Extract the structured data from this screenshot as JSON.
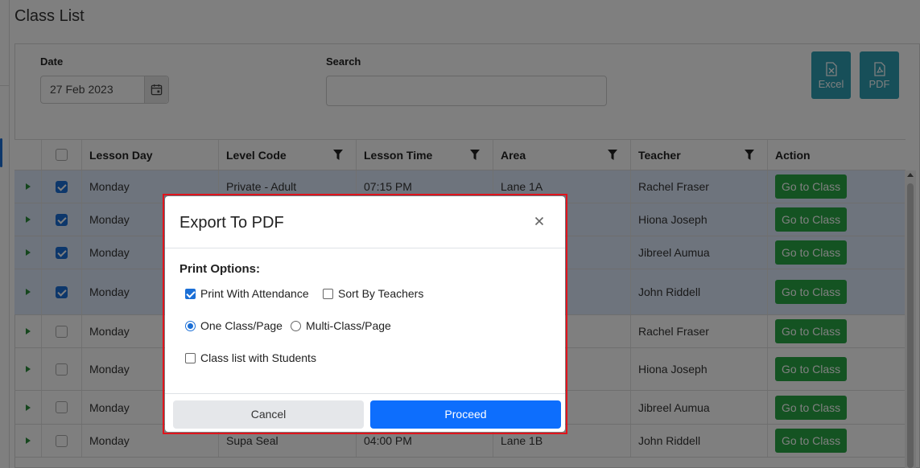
{
  "page": {
    "title": "Class List"
  },
  "filters": {
    "date_label": "Date",
    "date_value": "27 Feb 2023",
    "search_label": "Search",
    "search_value": ""
  },
  "export": {
    "excel_label": "Excel",
    "pdf_label": "PDF"
  },
  "grid": {
    "columns": [
      "Lesson Day",
      "Level Code",
      "Lesson Time",
      "Area",
      "Teacher",
      "Action"
    ],
    "rows": [
      {
        "selected": true,
        "day": "Monday",
        "level": "Private - Adult",
        "time": "07:15 PM",
        "area": "Lane 1A",
        "teacher": "Rachel Fraser",
        "action": "Go to Class"
      },
      {
        "selected": true,
        "day": "Monday",
        "level": "",
        "time": "",
        "area": "",
        "teacher": "Hiona Joseph",
        "action": "Go to Class"
      },
      {
        "selected": true,
        "day": "Monday",
        "level": "",
        "time": "",
        "area": "",
        "teacher": "Jibreel Aumua",
        "action": "Go to Class"
      },
      {
        "selected": true,
        "day": "Monday",
        "level": "",
        "time": "",
        "area": "",
        "teacher": "John Riddell",
        "action": "Go to Class"
      },
      {
        "selected": false,
        "day": "Monday",
        "level": "",
        "time": "",
        "area": "",
        "teacher": "Rachel Fraser",
        "action": "Go to Class"
      },
      {
        "selected": false,
        "day": "Monday",
        "level": "",
        "time": "",
        "area": "",
        "teacher": "Hiona Joseph",
        "action": "Go to Class"
      },
      {
        "selected": false,
        "day": "Monday",
        "level": "",
        "time": "",
        "area": "",
        "teacher": "Jibreel Aumua",
        "action": "Go to Class"
      },
      {
        "selected": false,
        "day": "Monday",
        "level": "Supa Seal",
        "time": "04:00 PM",
        "area": "Lane 1B",
        "teacher": "John Riddell",
        "action": "Go to Class"
      }
    ]
  },
  "modal": {
    "title": "Export To PDF",
    "section_title": "Print Options:",
    "print_with_attendance": {
      "label": "Print With Attendance",
      "checked": true
    },
    "sort_by_teachers": {
      "label": "Sort By Teachers",
      "checked": false
    },
    "one_class_per_page": {
      "label": "One Class/Page",
      "selected": true
    },
    "multi_class_per_page": {
      "label": "Multi-Class/Page",
      "selected": false
    },
    "class_list_with_students": {
      "label": "Class list with Students",
      "checked": false
    },
    "cancel_label": "Cancel",
    "proceed_label": "Proceed"
  },
  "colors": {
    "go_button": "#28a745",
    "primary": "#0d6efd",
    "export_button": "#2f9fb3",
    "modal_highlight": "#e0141c"
  }
}
